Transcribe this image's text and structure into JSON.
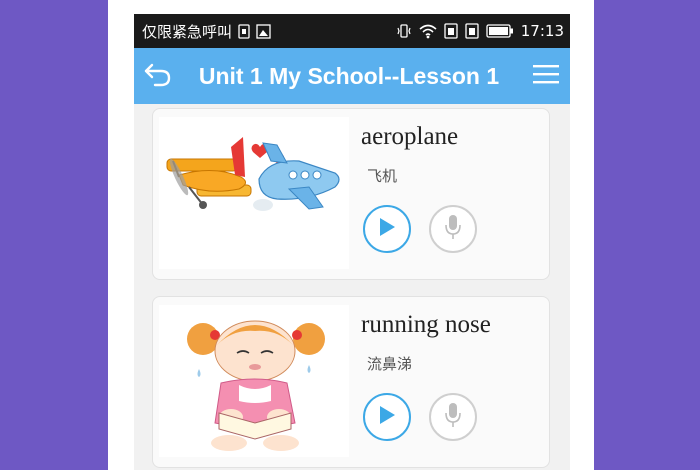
{
  "status_bar": {
    "carrier_text": "仅限紧急呼叫",
    "time": "17:13",
    "icons": [
      "sim-icon",
      "image-icon",
      "vibrate-icon",
      "wifi-icon",
      "sim1-icon",
      "sim2-icon",
      "battery-icon"
    ]
  },
  "header": {
    "title": "Unit 1 My School--Lesson 1",
    "background_color": "#5ab0ee",
    "back_icon": "back-arrow-icon",
    "menu_icon": "hamburger-menu-icon"
  },
  "words": [
    {
      "word": "aeroplane",
      "meaning": "飞机",
      "image": "aeroplane-illustration"
    },
    {
      "word": "running nose",
      "meaning": "流鼻涕",
      "image": "girl-with-running-nose-illustration"
    }
  ],
  "colors": {
    "page_background": "#6e58c4",
    "accent": "#3ca8e6",
    "record_gray": "#bdbdbd"
  }
}
